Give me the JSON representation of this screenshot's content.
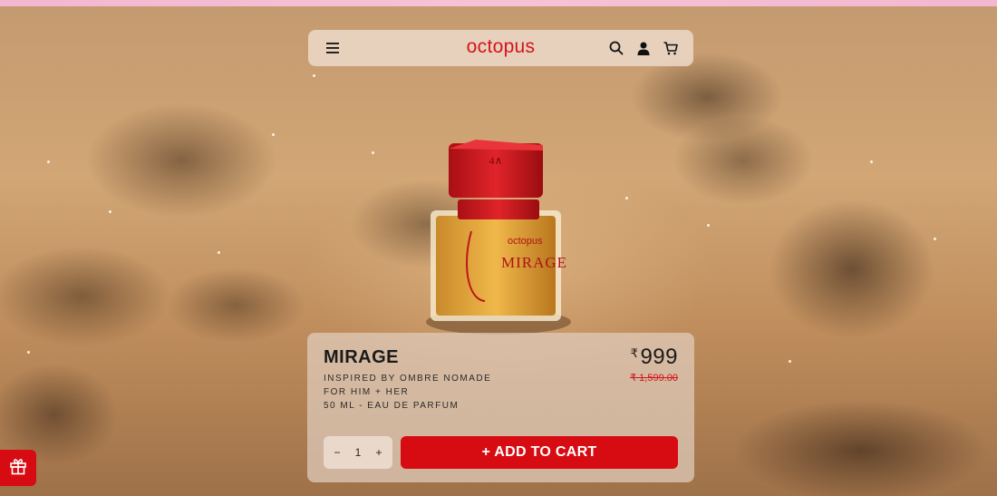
{
  "header": {
    "brand": "octopus",
    "icons": [
      "menu-icon",
      "search-icon",
      "account-icon",
      "cart-icon"
    ]
  },
  "product": {
    "name": "MIRAGE",
    "bottle_label_brand": "octopus",
    "bottle_label_name": "MIRAGE",
    "info_lines": [
      "INSPIRED BY OMBRE NOMADE",
      "FOR HIM + HER",
      "50 ML - EAU DE PARFUM"
    ],
    "currency": "₹",
    "price": "999",
    "original_price": "₹ 1,599.00"
  },
  "cart": {
    "quantity": "1",
    "decrement_label": "−",
    "increment_label": "+",
    "add_to_cart_label": "+ ADD TO CART"
  },
  "colors": {
    "accent_red": "#d70b12",
    "brand_red": "#d4141b",
    "top_bar_pink": "#f3b7cf"
  },
  "gift": {
    "icon": "gift-icon"
  }
}
